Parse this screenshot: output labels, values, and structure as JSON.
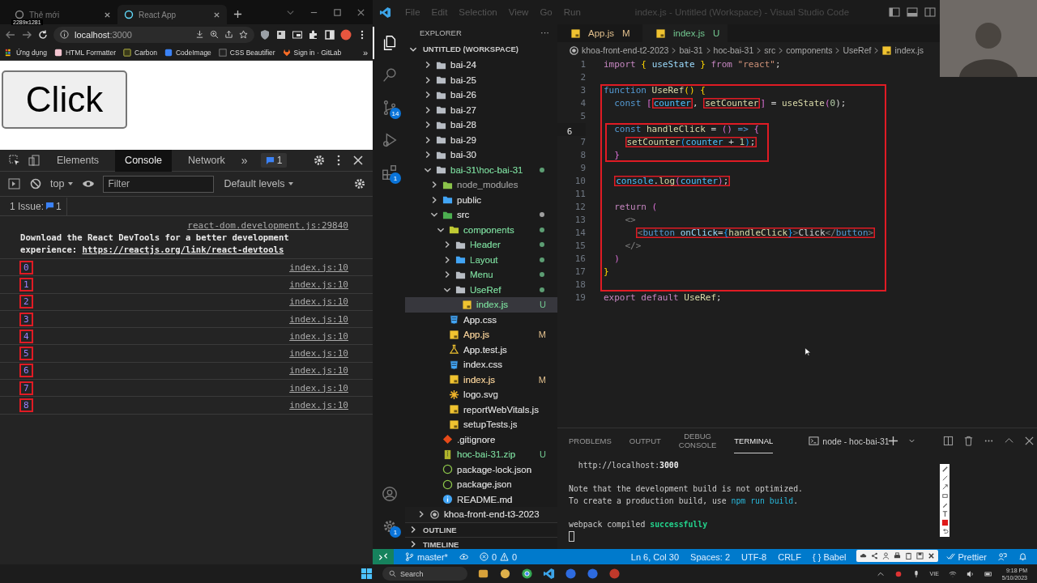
{
  "browser": {
    "tabs": [
      {
        "label": "Thẻ mới",
        "selected": false
      },
      {
        "label": "React App",
        "selected": true
      }
    ],
    "capture_size_label": "2289x1281",
    "address": {
      "host": "localhost",
      "port": ":3000"
    },
    "bookmarks": [
      {
        "label": "Ứng dụng",
        "kind": "apps"
      },
      {
        "label": "HTML Formatter",
        "kind": "formatter"
      },
      {
        "label": "Carbon",
        "kind": "carbon"
      },
      {
        "label": "CodeImage",
        "kind": "codeimage"
      },
      {
        "label": "CSS Beautifier",
        "kind": "beautifier"
      },
      {
        "label": "Sign in · GitLab",
        "kind": "gitlab"
      }
    ],
    "bookmarks_more": "»",
    "page": {
      "button": "Click"
    }
  },
  "devtools": {
    "tabs": [
      {
        "label": "Elements",
        "selected": false
      },
      {
        "label": "Console",
        "selected": true
      },
      {
        "label": "Network",
        "selected": false
      }
    ],
    "more": "»",
    "issues_badge": "1",
    "context": "top",
    "filter_placeholder": "Filter",
    "levels": "Default levels",
    "issues": {
      "label": "1 Issue:",
      "count": "1"
    },
    "info": {
      "source": "react-dom.development.js:29840",
      "text": "Download the React DevTools for a better development experience: ",
      "link": "https://reactjs.org/link/react-devtools"
    },
    "logs": [
      {
        "value": "0",
        "source": "index.js:10",
        "boxed": true
      },
      {
        "value": "1",
        "source": "index.js:10",
        "boxed": true
      },
      {
        "value": "2",
        "source": "index.js:10",
        "boxed": true
      },
      {
        "value": "3",
        "source": "index.js:10",
        "boxed": true
      },
      {
        "value": "4",
        "source": "index.js:10",
        "boxed": true
      },
      {
        "value": "5",
        "source": "index.js:10",
        "boxed": true
      },
      {
        "value": "6",
        "source": "index.js:10",
        "boxed": true
      },
      {
        "value": "7",
        "source": "index.js:10",
        "boxed": true
      },
      {
        "value": "8",
        "source": "index.js:10",
        "boxed": true
      }
    ]
  },
  "vscode": {
    "menu": [
      "File",
      "Edit",
      "Selection",
      "View",
      "Go",
      "Run"
    ],
    "title": "index.js - Untitled (Workspace) - Visual Studio Code",
    "activity": [
      {
        "kind": "files",
        "selected": true
      },
      {
        "kind": "search",
        "selected": false
      },
      {
        "kind": "source-control",
        "selected": false,
        "badge": "14"
      },
      {
        "kind": "run",
        "selected": false
      },
      {
        "kind": "extensions",
        "selected": false,
        "badge": "1"
      }
    ],
    "activity_bottom": [
      {
        "kind": "account"
      },
      {
        "kind": "settings",
        "badge": "1"
      }
    ],
    "explorer": {
      "title": "EXPLORER",
      "more": "···",
      "section": "UNTITLED (WORKSPACE)",
      "tree": [
        {
          "name": "bai-24",
          "kind": "folder",
          "expanded": false,
          "color": "#cccccc",
          "dot": false,
          "selected": false
        },
        {
          "name": "bai-25",
          "kind": "folder",
          "expanded": false,
          "color": "#cccccc",
          "dot": false,
          "selected": false
        },
        {
          "name": "bai-26",
          "kind": "folder",
          "expanded": false,
          "color": "#cccccc",
          "dot": false,
          "selected": false
        },
        {
          "name": "bai-27",
          "kind": "folder",
          "expanded": false,
          "color": "#cccccc",
          "dot": false,
          "selected": false
        },
        {
          "name": "bai-28",
          "kind": "folder",
          "expanded": false,
          "color": "#cccccc",
          "dot": false,
          "selected": false
        },
        {
          "name": "bai-29",
          "kind": "folder",
          "expanded": false,
          "color": "#cccccc",
          "dot": false,
          "selected": false
        },
        {
          "name": "bai-30",
          "kind": "folder",
          "expanded": false,
          "color": "#cccccc",
          "dot": false,
          "selected": false
        },
        {
          "name": "bai-31\\hoc-bai-31",
          "kind": "folder",
          "expanded": true,
          "color": "#73c991",
          "dot": true,
          "selected": false,
          "children": [
            {
              "name": "node_modules",
              "kind": "folder-node",
              "expanded": false,
              "color": "#8c8c8c",
              "dot": false,
              "selected": false
            },
            {
              "name": "public",
              "kind": "folder-public",
              "expanded": false,
              "color": "#cccccc",
              "dot": false,
              "selected": false
            },
            {
              "name": "src",
              "kind": "folder-src",
              "expanded": true,
              "color": "#cccccc",
              "dot": true,
              "selected": false,
              "children": [
                {
                  "name": "components",
                  "kind": "folder-components",
                  "expanded": true,
                  "color": "#73c991",
                  "dot": true,
                  "selected": false,
                  "children": [
                    {
                      "name": "Header",
                      "kind": "folder",
                      "expanded": false,
                      "color": "#73c991",
                      "dot": true,
                      "selected": false
                    },
                    {
                      "name": "Layout",
                      "kind": "folder-layout",
                      "expanded": false,
                      "color": "#73c991",
                      "dot": true,
                      "selected": false
                    },
                    {
                      "name": "Menu",
                      "kind": "folder",
                      "expanded": false,
                      "color": "#73c991",
                      "dot": true,
                      "selected": false
                    },
                    {
                      "name": "UseRef",
                      "kind": "folder",
                      "expanded": true,
                      "color": "#73c991",
                      "dot": true,
                      "selected": false,
                      "children": [
                        {
                          "name": "index.js",
                          "kind": "js",
                          "color": "#73c991",
                          "badge": "U",
                          "dot": false,
                          "selected": true
                        }
                      ]
                    }
                  ]
                },
                {
                  "name": "App.css",
                  "kind": "css",
                  "color": "#cccccc",
                  "dot": false,
                  "selected": false
                },
                {
                  "name": "App.js",
                  "kind": "js",
                  "color": "#e2c08d",
                  "badge": "M",
                  "dot": false,
                  "selected": false
                },
                {
                  "name": "App.test.js",
                  "kind": "test",
                  "color": "#cccccc",
                  "dot": false,
                  "selected": false
                },
                {
                  "name": "index.css",
                  "kind": "css",
                  "color": "#cccccc",
                  "dot": false,
                  "selected": false
                },
                {
                  "name": "index.js",
                  "kind": "js",
                  "color": "#e2c08d",
                  "badge": "M",
                  "dot": false,
                  "selected": false
                },
                {
                  "name": "logo.svg",
                  "kind": "svg",
                  "color": "#cccccc",
                  "dot": false,
                  "selected": false
                },
                {
                  "name": "reportWebVitals.js",
                  "kind": "js",
                  "color": "#cccccc",
                  "dot": false,
                  "selected": false
                },
                {
                  "name": "setupTests.js",
                  "kind": "js",
                  "color": "#cccccc",
                  "dot": false,
                  "selected": false
                }
              ]
            },
            {
              "name": ".gitignore",
              "kind": "git",
              "color": "#cccccc",
              "dot": false,
              "selected": false
            },
            {
              "name": "hoc-bai-31.zip",
              "kind": "zip",
              "color": "#73c991",
              "badge": "U",
              "dot": false,
              "selected": false
            },
            {
              "name": "package-lock.json",
              "kind": "json",
              "color": "#cccccc",
              "dot": false,
              "selected": false
            },
            {
              "name": "package.json",
              "kind": "json",
              "color": "#cccccc",
              "dot": false,
              "selected": false
            },
            {
              "name": "README.md",
              "kind": "info",
              "color": "#cccccc",
              "dot": false,
              "selected": false
            }
          ]
        }
      ],
      "roots": [
        {
          "name": "khoa-front-end-t3-2023",
          "expanded": false
        }
      ],
      "outline": "OUTLINE",
      "timeline": "TIMELINE"
    },
    "editor": {
      "tabs": [
        {
          "label": "App.js",
          "badge": "M",
          "selected": false
        },
        {
          "label": "index.js",
          "badge": "U",
          "selected": true
        }
      ],
      "breadcrumbs": [
        "khoa-front-end-t2-2023",
        "bai-31",
        "hoc-bai-31",
        "src",
        "components",
        "UseRef",
        "index.js"
      ],
      "code": [
        {
          "number": "1",
          "active": false,
          "tokens": [
            {
              "text": "import",
              "kind": "ctl"
            },
            {
              "text": " { ",
              "kind": "brace"
            },
            {
              "text": "useState",
              "kind": "var"
            },
            {
              "text": " } ",
              "kind": "brace"
            },
            {
              "text": "from ",
              "kind": "ctl"
            },
            {
              "text": "\"react\"",
              "kind": "str"
            },
            {
              "text": ";",
              "kind": "punct"
            }
          ]
        },
        {
          "number": "2",
          "active": false
        },
        {
          "kind": "frame",
          "children": [
            {
              "number": "3",
              "active": false,
              "tokens": [
                {
                  "text": "function ",
                  "kind": "kw"
                },
                {
                  "text": "UseRef",
                  "kind": "fn"
                },
                {
                  "text": "() {",
                  "kind": "brace"
                }
              ]
            },
            {
              "number": "4",
              "active": false,
              "tokens": [
                {
                  "text": "  const ",
                  "kind": "kw"
                },
                {
                  "text": "[",
                  "kind": "brace2"
                },
                {
                  "text": "counter",
                  "kind": "cv",
                  "boxed": true
                },
                {
                  "text": ", ",
                  "kind": "punct"
                },
                {
                  "text": "setCounter",
                  "kind": "fn",
                  "boxed": true
                },
                {
                  "text": "]",
                  "kind": "brace2"
                },
                {
                  "text": " = ",
                  "kind": "punct"
                },
                {
                  "text": "useState",
                  "kind": "fn"
                },
                {
                  "text": "(",
                  "kind": "brace2"
                },
                {
                  "text": "0",
                  "kind": "num"
                },
                {
                  "text": ");",
                  "kind": "punct"
                }
              ]
            },
            {
              "number": "5",
              "active": false
            },
            {
              "kind": "frame",
              "children": [
                {
                  "number": "6",
                  "active": true,
                  "tokens": [
                    {
                      "text": "  const ",
                      "kind": "kw"
                    },
                    {
                      "text": "handleClick",
                      "kind": "fn"
                    },
                    {
                      "text": " = ",
                      "kind": "punct"
                    },
                    {
                      "text": "() ",
                      "kind": "brace2"
                    },
                    {
                      "text": "=> ",
                      "kind": "kw"
                    },
                    {
                      "text": "{",
                      "kind": "brace2"
                    }
                  ]
                },
                {
                  "number": "7",
                  "active": false,
                  "boxed": true,
                  "tokens": [
                    {
                      "text": "    setCounter",
                      "kind": "fn"
                    },
                    {
                      "text": "(",
                      "kind": "brace3"
                    },
                    {
                      "text": "counter",
                      "kind": "cv"
                    },
                    {
                      "text": " + ",
                      "kind": "punct"
                    },
                    {
                      "text": "1",
                      "kind": "num"
                    },
                    {
                      "text": ")",
                      "kind": "brace3"
                    },
                    {
                      "text": ";",
                      "kind": "punct"
                    }
                  ]
                },
                {
                  "number": "8",
                  "active": false,
                  "tokens": [
                    {
                      "text": "  }",
                      "kind": "brace2"
                    }
                  ]
                }
              ]
            },
            {
              "number": "9",
              "active": false
            },
            {
              "number": "10",
              "active": false,
              "boxed": true,
              "tokens": [
                {
                  "text": "  console",
                  "kind": "cv"
                },
                {
                  "text": ".",
                  "kind": "punct"
                },
                {
                  "text": "log",
                  "kind": "fn"
                },
                {
                  "text": "(",
                  "kind": "brace2"
                },
                {
                  "text": "counter",
                  "kind": "cv"
                },
                {
                  "text": ")",
                  "kind": "brace2"
                },
                {
                  "text": ";",
                  "kind": "punct"
                }
              ]
            },
            {
              "number": "11",
              "active": false
            },
            {
              "number": "12",
              "active": false,
              "tokens": [
                {
                  "text": "  return ",
                  "kind": "ctl"
                },
                {
                  "text": "(",
                  "kind": "brace2"
                }
              ]
            },
            {
              "number": "13",
              "active": false,
              "tokens": [
                {
                  "text": "    <>",
                  "kind": "tagp"
                }
              ]
            },
            {
              "number": "14",
              "active": false,
              "boxed": true,
              "tokens": [
                {
                  "text": "      <",
                  "kind": "tagp"
                },
                {
                  "text": "button ",
                  "kind": "tag"
                },
                {
                  "text": "onClick",
                  "kind": "var"
                },
                {
                  "text": "=",
                  "kind": "punct"
                },
                {
                  "text": "{",
                  "kind": "brace3"
                },
                {
                  "text": "handleClick",
                  "kind": "fn"
                },
                {
                  "text": "}",
                  "kind": "brace3"
                },
                {
                  "text": ">",
                  "kind": "tagp"
                },
                {
                  "text": "Click",
                  "kind": "punct"
                },
                {
                  "text": "</",
                  "kind": "tagp"
                },
                {
                  "text": "button",
                  "kind": "tag"
                },
                {
                  "text": ">",
                  "kind": "tagp"
                }
              ]
            },
            {
              "number": "15",
              "active": false,
              "tokens": [
                {
                  "text": "    </>",
                  "kind": "tagp"
                }
              ]
            },
            {
              "number": "16",
              "active": false,
              "tokens": [
                {
                  "text": "  )",
                  "kind": "brace2"
                }
              ]
            },
            {
              "number": "17",
              "active": false,
              "tokens": [
                {
                  "text": "}",
                  "kind": "brace"
                }
              ]
            },
            {
              "number": "18",
              "active": false
            }
          ]
        },
        {
          "number": "19",
          "active": false,
          "tokens": [
            {
              "text": "export default ",
              "kind": "ctl"
            },
            {
              "text": "UseRef",
              "kind": "fn"
            },
            {
              "text": ";",
              "kind": "punct"
            }
          ]
        }
      ]
    },
    "panel": {
      "tabs": [
        {
          "label": "PROBLEMS",
          "selected": false
        },
        {
          "label": "OUTPUT",
          "selected": false
        },
        {
          "label": "DEBUG CONSOLE",
          "selected": false
        },
        {
          "label": "TERMINAL",
          "selected": true
        }
      ],
      "terminal_name": "node - hoc-bai-31",
      "lines": [
        {
          "kind": "text",
          "tokens": [
            {
              "text": "  http://localhost:",
              "kind": "plain"
            },
            {
              "text": "3000",
              "kind": "bold"
            }
          ]
        },
        {
          "kind": "blank"
        },
        {
          "kind": "text",
          "tokens": [
            {
              "text": "Note that the development build is not optimized.",
              "kind": "plain"
            }
          ]
        },
        {
          "kind": "text",
          "tokens": [
            {
              "text": "To create a production build, use ",
              "kind": "plain"
            },
            {
              "text": "npm run build",
              "kind": "link"
            },
            {
              "text": ".",
              "kind": "plain"
            }
          ]
        },
        {
          "kind": "blank"
        },
        {
          "kind": "text",
          "tokens": [
            {
              "text": "webpack compiled ",
              "kind": "plain"
            },
            {
              "text": "successfully",
              "kind": "ok"
            }
          ]
        },
        {
          "kind": "cursor"
        }
      ]
    },
    "status": {
      "branch": "master*",
      "errors": "0",
      "warnings": "0",
      "items": [
        "Ln 6, Col 30",
        "Spaces: 2",
        "UTF-8",
        "CRLF",
        "{ } Babel"
      ],
      "formatter": "Prettier"
    }
  },
  "taskbar": {
    "search": "Search",
    "language": "VIE",
    "time": "9:18 PM",
    "date": "5/10/2023"
  }
}
